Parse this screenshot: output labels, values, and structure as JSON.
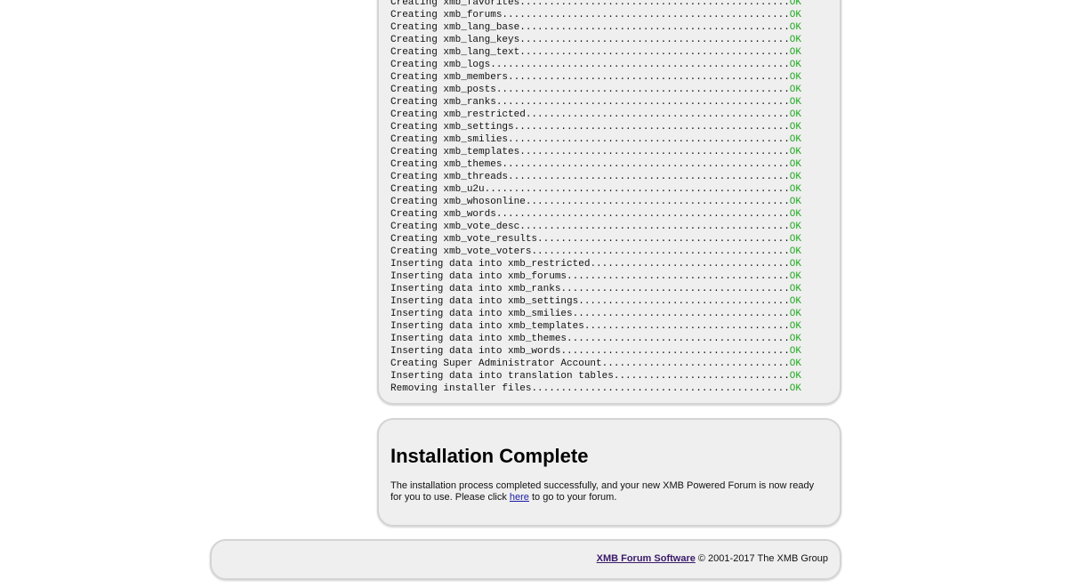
{
  "log": {
    "lines": [
      {
        "text": "Creating xmb_favorites",
        "status": "OK"
      },
      {
        "text": "Creating xmb_forums",
        "status": "OK"
      },
      {
        "text": "Creating xmb_lang_base",
        "status": "OK"
      },
      {
        "text": "Creating xmb_lang_keys",
        "status": "OK"
      },
      {
        "text": "Creating xmb_lang_text",
        "status": "OK"
      },
      {
        "text": "Creating xmb_logs",
        "status": "OK"
      },
      {
        "text": "Creating xmb_members",
        "status": "OK"
      },
      {
        "text": "Creating xmb_posts",
        "status": "OK"
      },
      {
        "text": "Creating xmb_ranks",
        "status": "OK"
      },
      {
        "text": "Creating xmb_restricted",
        "status": "OK"
      },
      {
        "text": "Creating xmb_settings",
        "status": "OK"
      },
      {
        "text": "Creating xmb_smilies",
        "status": "OK"
      },
      {
        "text": "Creating xmb_templates",
        "status": "OK"
      },
      {
        "text": "Creating xmb_themes",
        "status": "OK"
      },
      {
        "text": "Creating xmb_threads",
        "status": "OK"
      },
      {
        "text": "Creating xmb_u2u",
        "status": "OK"
      },
      {
        "text": "Creating xmb_whosonline",
        "status": "OK"
      },
      {
        "text": "Creating xmb_words",
        "status": "OK"
      },
      {
        "text": "Creating xmb_vote_desc",
        "status": "OK"
      },
      {
        "text": "Creating xmb_vote_results",
        "status": "OK"
      },
      {
        "text": "Creating xmb_vote_voters",
        "status": "OK"
      },
      {
        "text": "Inserting data into xmb_restricted",
        "status": "OK"
      },
      {
        "text": "Inserting data into xmb_forums",
        "status": "OK"
      },
      {
        "text": "Inserting data into xmb_ranks",
        "status": "OK"
      },
      {
        "text": "Inserting data into xmb_settings",
        "status": "OK"
      },
      {
        "text": "Inserting data into xmb_smilies",
        "status": "OK"
      },
      {
        "text": "Inserting data into xmb_templates",
        "status": "OK"
      },
      {
        "text": "Inserting data into xmb_themes",
        "status": "OK"
      },
      {
        "text": "Inserting data into xmb_words",
        "status": "OK"
      },
      {
        "text": "Creating Super Administrator Account",
        "status": "OK"
      },
      {
        "text": "Inserting data into translation tables",
        "status": "OK"
      },
      {
        "text": "Removing installer files",
        "status": "OK"
      }
    ],
    "status_color": "#22aa22"
  },
  "complete": {
    "title": "Installation Complete",
    "text_before": "The installation process completed successfully, and your new XMB Powered Forum is now ready for you to use. Please click ",
    "link_label": "here",
    "text_after": " to go to your forum."
  },
  "footer": {
    "link_label": "XMB Forum Software",
    "copyright": " © 2001-2017 The XMB Group"
  }
}
